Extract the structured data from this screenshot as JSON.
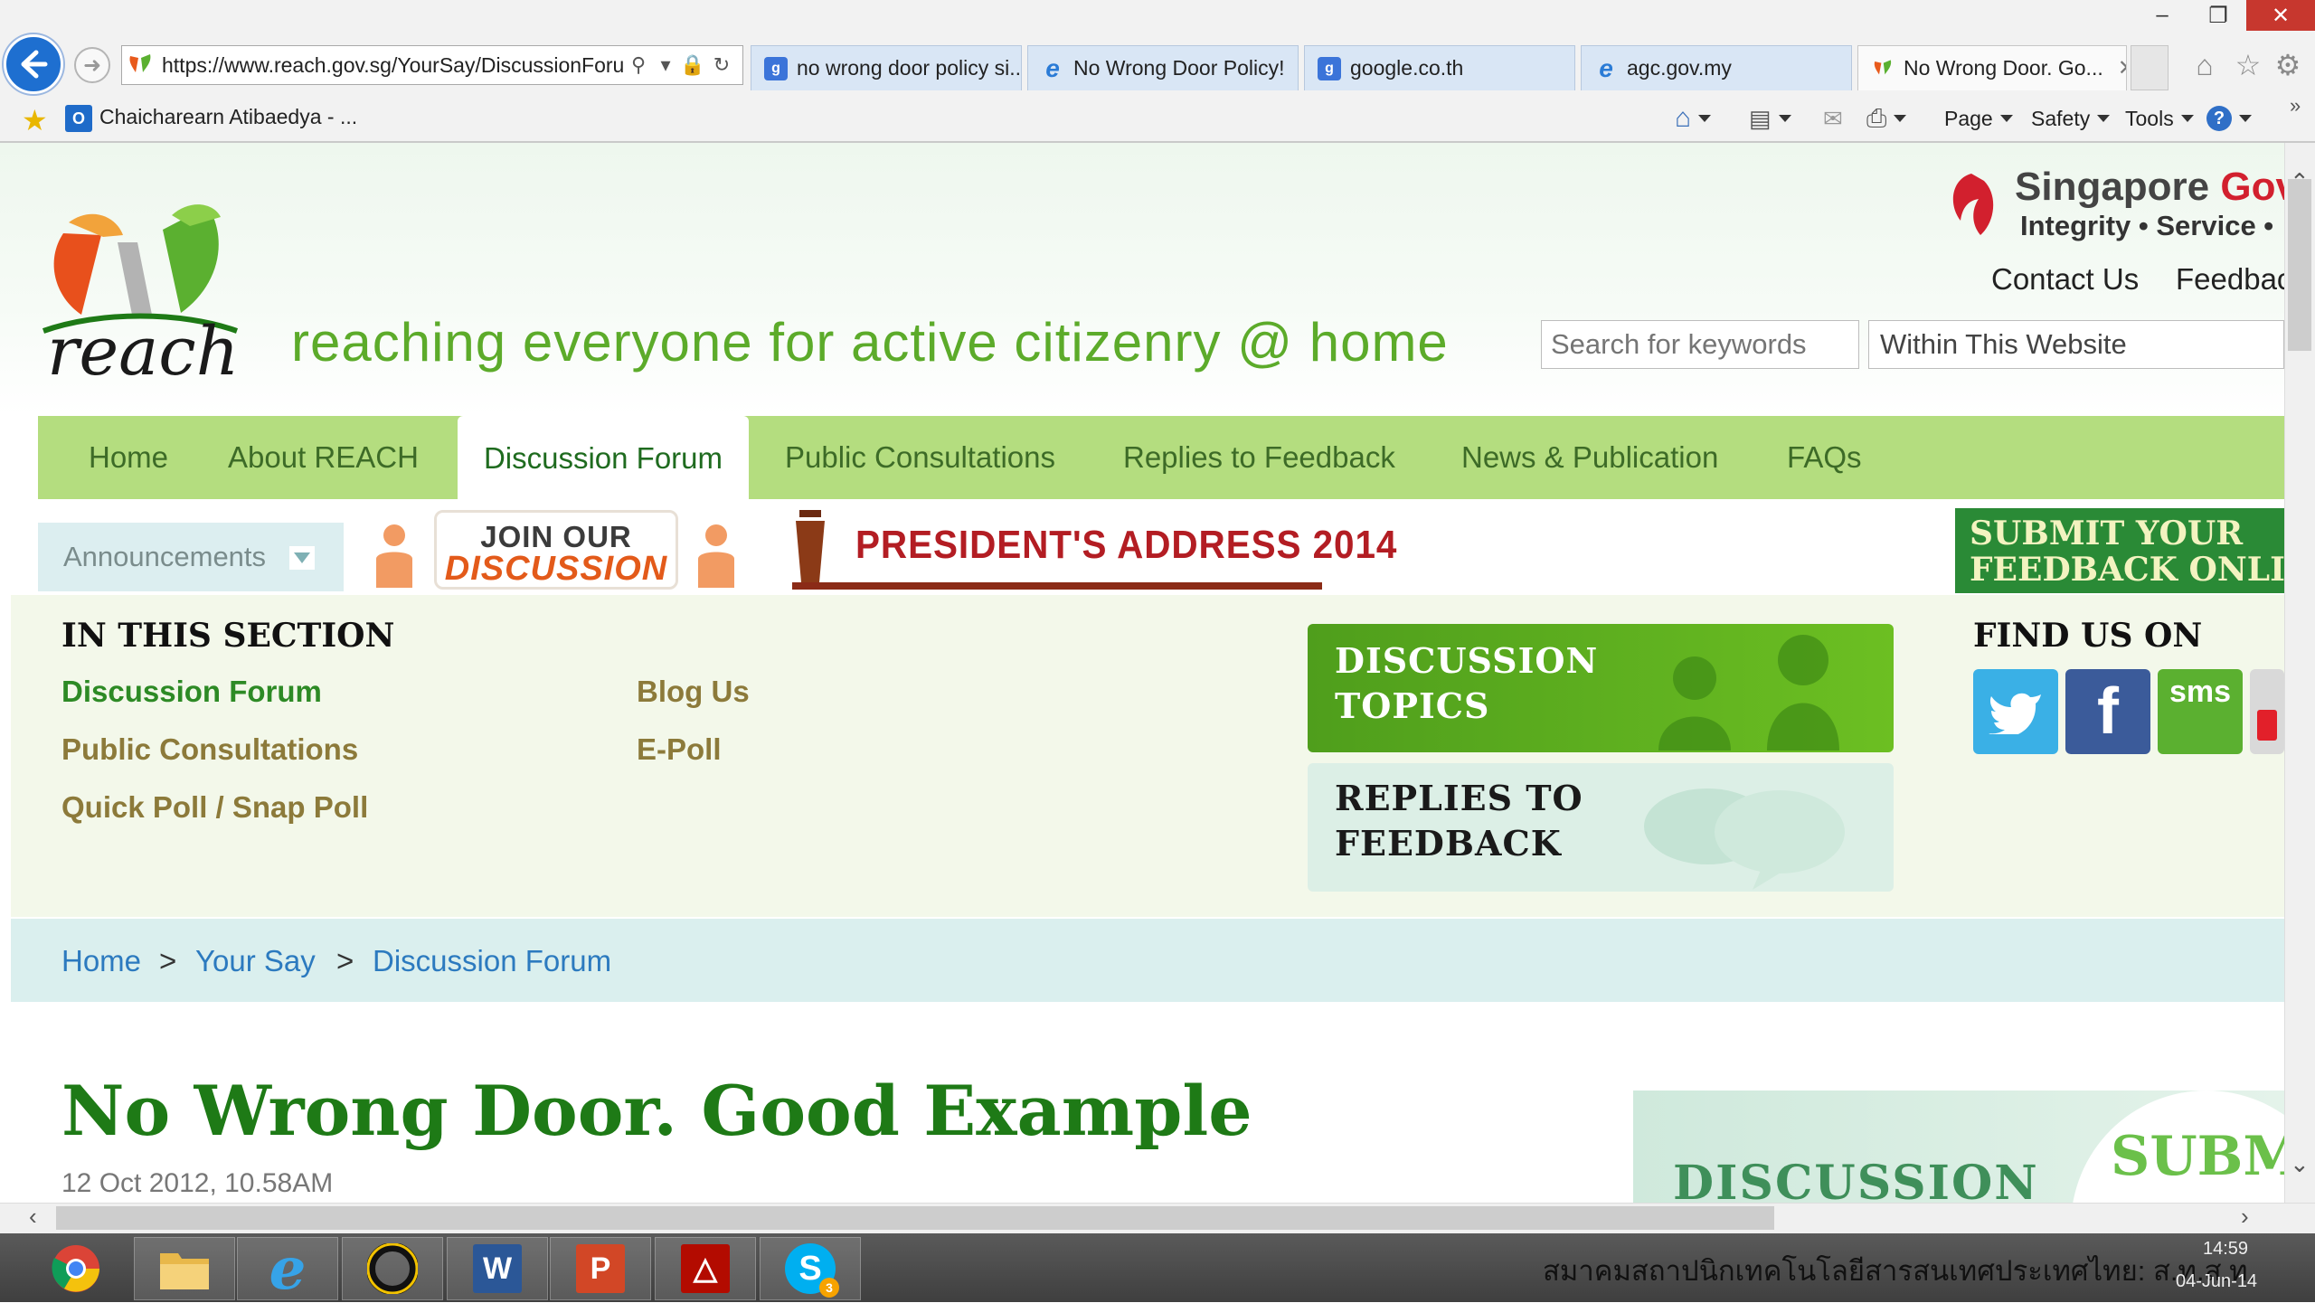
{
  "browser": {
    "url": "https://www.reach.gov.sg/YourSay/DiscussionForu",
    "tabs": [
      {
        "label": "no wrong door policy si...",
        "icon": "google-icon"
      },
      {
        "label": "No Wrong Door Policy!",
        "icon": "ie-icon"
      },
      {
        "label": "google.co.th",
        "icon": "google-icon"
      },
      {
        "label": "agc.gov.my",
        "icon": "ie-icon"
      },
      {
        "label": "No Wrong Door. Go...",
        "icon": "reach-icon",
        "active": true
      }
    ],
    "favorites": {
      "item": "Chaicharearn Atibaedya - ..."
    },
    "commands": {
      "page": "Page",
      "safety": "Safety",
      "tools": "Tools"
    }
  },
  "site": {
    "logo_word": "reach",
    "tagline": "reaching everyone for active citizenry @ home",
    "gov_title_a": "Singapore ",
    "gov_title_b": "Gov",
    "gov_sub": "Integrity • Service •",
    "contact": "Contact Us",
    "feedback": "Feedbac",
    "search_placeholder": "Search for keywords",
    "search_scope": "Within This Website"
  },
  "nav": {
    "items": [
      "Home",
      "About REACH",
      "Discussion Forum",
      "Public Consultations",
      "Replies to Feedback",
      "News & Publication",
      "FAQs"
    ],
    "active": "Discussion Forum"
  },
  "banners": {
    "announcements": "Announcements",
    "join_line1": "JOIN OUR",
    "join_line2": "DISCUSSION",
    "presidents_address": "PRESIDENT'S ADDRESS 2014",
    "submit_line1": "SUBMIT YOUR",
    "submit_line2": "FEEDBACK ONLI"
  },
  "section": {
    "title": "IN THIS SECTION",
    "links_col1": [
      "Discussion Forum",
      "Public Consultations",
      "Quick Poll / Snap Poll"
    ],
    "links_col2": [
      "Blog Us",
      "E-Poll"
    ],
    "card_topics_l1": "DISCUSSION",
    "card_topics_l2": "TOPICS",
    "card_replies_l1": "REPLIES TO",
    "card_replies_l2": "FEEDBACK",
    "find_us": "FIND US ON",
    "social_sms": "sms"
  },
  "breadcrumb": [
    "Home",
    "Your Say",
    "Discussion Forum"
  ],
  "article": {
    "title": "No Wrong Door. Good Example",
    "date": "12 Oct 2012, 10.58AM",
    "side_card": "DISCUSSION",
    "side_submit": "SUBM"
  },
  "taskbar": {
    "apps": [
      "chrome",
      "file-explorer",
      "internet-explorer",
      "app-circle",
      "word",
      "powerpoint",
      "acrobat",
      "skype"
    ],
    "skype_badge": "3",
    "tray_text": "สมาคมสถาปนิกเทคโนโลยีสารสนเทศประเทศไทย: ส.ท.ส.ท.",
    "time": "14:59",
    "date": "04-Jun-14"
  },
  "colors": {
    "nav_bg": "#b4dd7f",
    "brand_green": "#1e7a16",
    "link_gold": "#8c7a3a",
    "breadcrumb_blue": "#2c7abf",
    "president_red": "#b31d23"
  }
}
